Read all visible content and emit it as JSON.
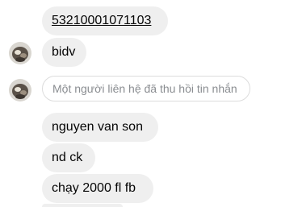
{
  "messages": [
    {
      "id": "msg1",
      "text": "53210001071103",
      "style": "link"
    },
    {
      "id": "msg2",
      "text": "bidv"
    },
    {
      "id": "msg3",
      "text": "Một người liên hệ đã thu hồi tin nhắn",
      "style": "unsent"
    },
    {
      "id": "msg4",
      "text": "nguyen van son"
    },
    {
      "id": "msg5",
      "text": "nd ck"
    },
    {
      "id": "msg6",
      "text": "chạy 2000 fl fb"
    }
  ],
  "colors": {
    "bubble_bg": "#efefef",
    "text": "#050505",
    "unsent_text": "#8a8d91",
    "unsent_border": "#dcdcdc"
  }
}
